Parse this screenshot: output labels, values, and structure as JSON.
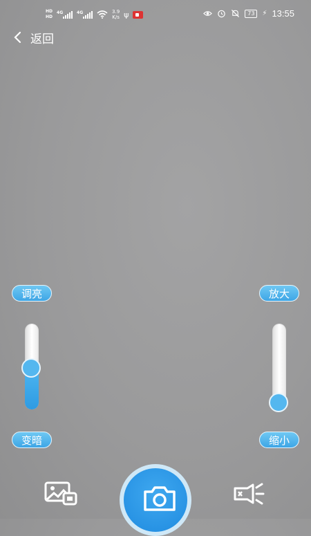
{
  "status_bar": {
    "hd_top": "HD",
    "hd_bottom": "HD",
    "sim1_gen": "4G",
    "sim2_gen": "4G",
    "speed_value": "3.9",
    "speed_unit": "K/s",
    "battery": "73",
    "time": "13:55"
  },
  "nav": {
    "back_label": "返回"
  },
  "left_slider": {
    "top_label": "调亮",
    "bottom_label": "变暗",
    "level": 0.48
  },
  "right_slider": {
    "top_label": "放大",
    "bottom_label": "缩小",
    "level": 0.0
  },
  "colors": {
    "accent": "#3ea6e6",
    "shutter": "#1f8be0"
  },
  "icons": [
    "gallery-icon",
    "camera-icon",
    "flashlight-icon",
    "back-chevron-icon"
  ]
}
